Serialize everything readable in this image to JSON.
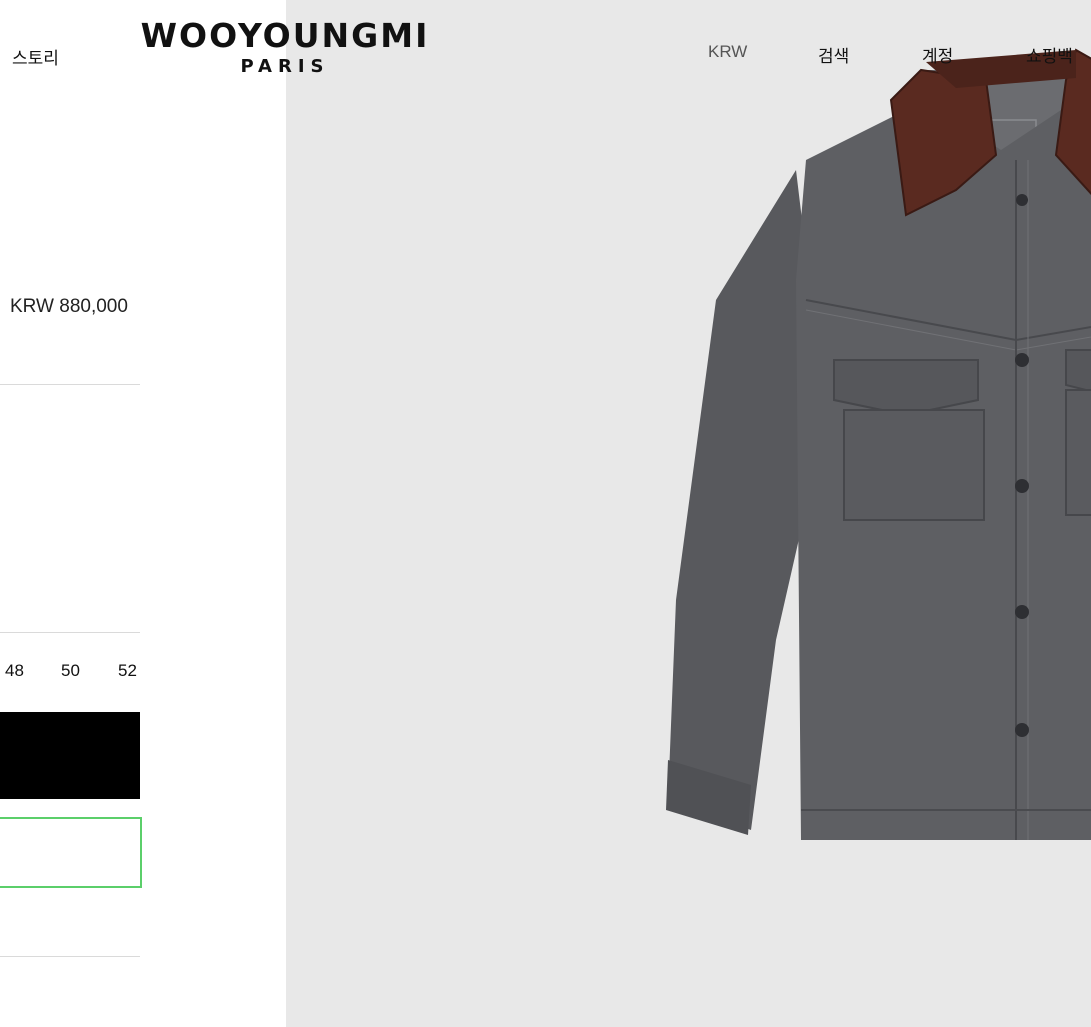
{
  "header": {
    "nav_story": "스토리",
    "logo_main": "WOOYOUNGMI",
    "logo_sub": "PARIS",
    "currency": "KRW",
    "search": "검색",
    "account": "계정",
    "bag": "쇼핑백"
  },
  "product": {
    "price": "KRW 880,000",
    "sizes": [
      "48",
      "50",
      "52"
    ]
  },
  "colors": {
    "accent_outline": "#5bcf6a",
    "image_background": "#e8e8e8",
    "denim": "#5a5b5f",
    "leather_collar": "#5a2a20"
  }
}
